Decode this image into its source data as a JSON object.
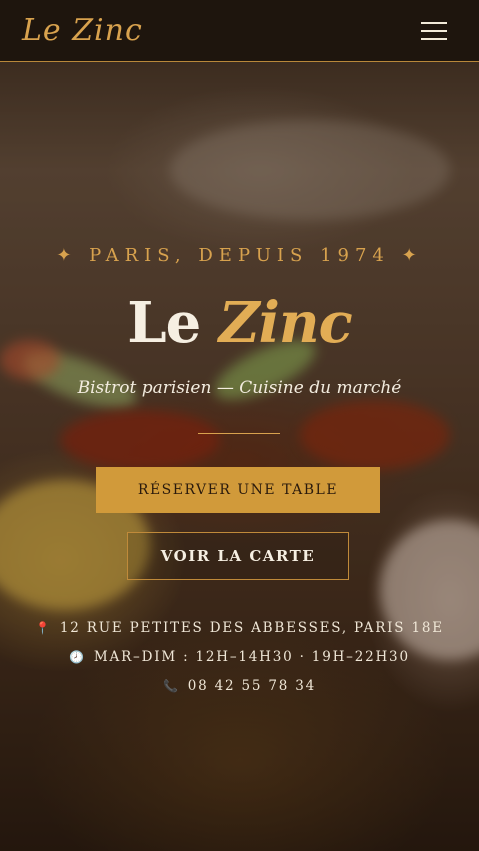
{
  "header": {
    "logo": "Le Zinc",
    "menu_icon": "hamburger-menu-icon"
  },
  "hero": {
    "tagline": "✦  PARIS, DEPUIS 1974  ✦",
    "title_le": "Le",
    "title_zinc": "Zinc",
    "subtitle": "Bistrot parisien — Cuisine du marché",
    "reserve_label": "RÉSERVER UNE TABLE",
    "menu_label": "VOIR LA CARTE"
  },
  "info": {
    "address": "12 RUE PETITES DES ABBESSES, PARIS 18E",
    "hours": "MAR–DIM : 12H–14H30 · 19H–22H30",
    "phone": "08 42 55 78 34",
    "address_icon": "map-pin-icon",
    "hours_icon": "clock-icon",
    "phone_icon": "phone-icon"
  },
  "colors": {
    "accent": "#d19a3a",
    "header_bg": "#1e150d",
    "text_light": "#f6efe2"
  }
}
